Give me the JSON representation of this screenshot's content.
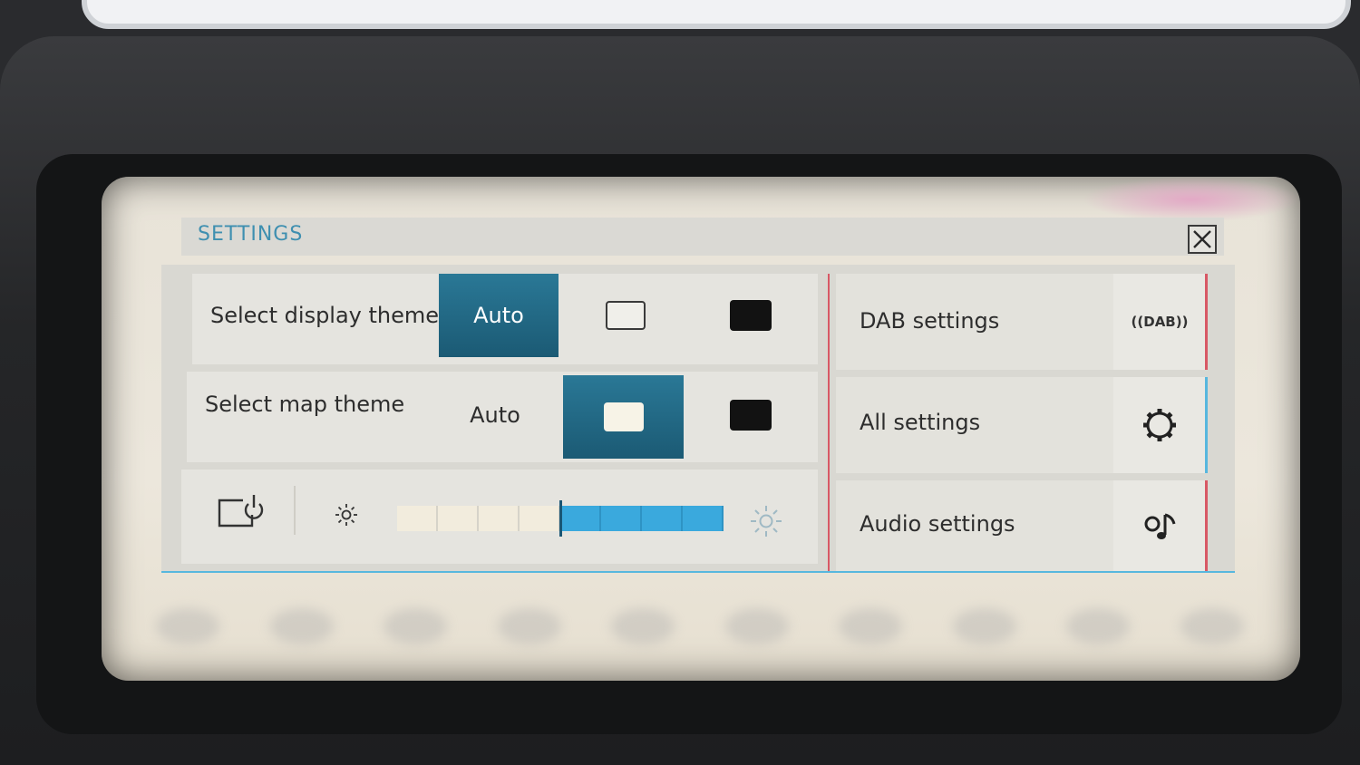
{
  "panel": {
    "title": "SETTINGS"
  },
  "display_theme": {
    "label": "Select display theme",
    "options": [
      "Auto",
      "light-theme",
      "dark-theme"
    ],
    "selected": "Auto"
  },
  "map_theme": {
    "label": "Select map theme",
    "options": [
      "Auto",
      "light-theme",
      "dark-theme"
    ],
    "selected": "light-theme"
  },
  "brightness": {
    "segments_total": 8,
    "level": 0.5
  },
  "right_menu": {
    "dab": {
      "label": "DAB settings",
      "icon_text": "((DAB))"
    },
    "all": {
      "label": "All settings"
    },
    "audio": {
      "label": "Audio settings"
    }
  },
  "colors": {
    "accent": "#2a7896",
    "divider": "#d85865",
    "bar": "#3aa9dd"
  }
}
